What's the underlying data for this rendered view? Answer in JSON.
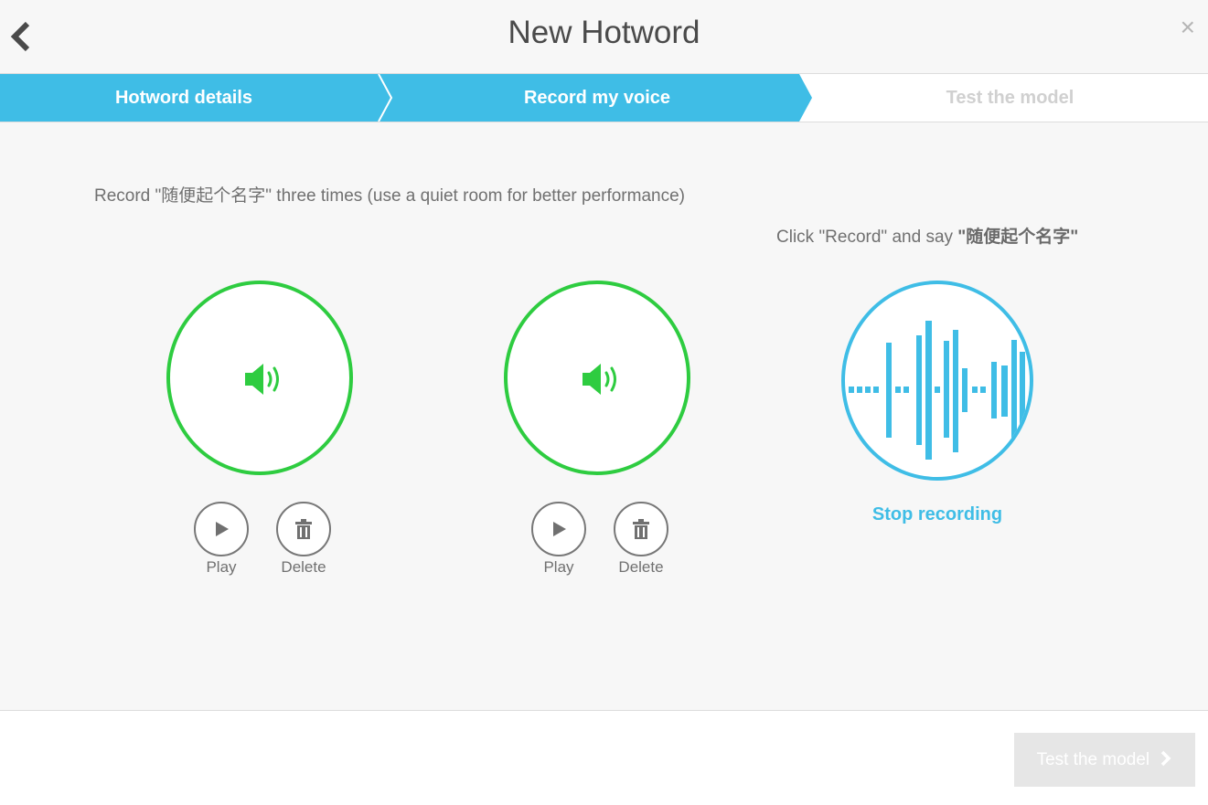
{
  "header": {
    "title": "New Hotword",
    "close_label": "×"
  },
  "steps": [
    {
      "label": "Hotword details",
      "state": "done"
    },
    {
      "label": "Record my voice",
      "state": "active"
    },
    {
      "label": "Test the model",
      "state": "pending"
    }
  ],
  "instruction": "Record \"随便起个名字\" three times (use a quiet room for better performance)",
  "prompt": {
    "prefix": "Click \"Record\" and say ",
    "hotword": "\"随便起个名字\""
  },
  "recordings": [
    {
      "status": "recorded",
      "play_label": "Play",
      "delete_label": "Delete",
      "icon": "speaker-icon"
    },
    {
      "status": "recorded",
      "play_label": "Play",
      "delete_label": "Delete",
      "icon": "speaker-icon"
    },
    {
      "status": "recording",
      "stop_label": "Stop recording",
      "icon": "waveform-icon"
    }
  ],
  "footer": {
    "next_label": "Test the model"
  },
  "colors": {
    "accent": "#3fbde6",
    "recorded": "#2ecc40",
    "text": "#707070",
    "disabled": "#e6e6e6"
  }
}
